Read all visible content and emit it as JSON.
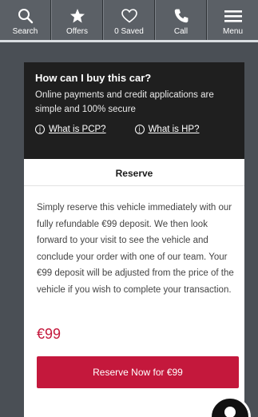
{
  "nav": {
    "items": [
      {
        "label": "Search",
        "icon": "search-icon"
      },
      {
        "label": "Offers",
        "icon": "star-icon"
      },
      {
        "label": "0 Saved",
        "icon": "heart-icon"
      },
      {
        "label": "Call",
        "icon": "phone-icon"
      },
      {
        "label": "Menu",
        "icon": "hamburger-icon"
      }
    ]
  },
  "buy_panel": {
    "title": "How can I buy this car?",
    "body": "Online payments and credit applications are simple and 100% secure",
    "links": [
      "What is PCP?",
      "What is HP?"
    ]
  },
  "reserve": {
    "heading": "Reserve",
    "text": "Simply reserve this vehicle immediately with our fully refundable €99 deposit. We then look forward to your visit to see the vehicle and conclude your order with one of our team. Your €99 deposit will be adjusted from the price of the vehicle if you wish to complete your transaction.",
    "price": "€99",
    "button_label": "Reserve Now for €99"
  },
  "colors": {
    "accent": "#c4183c",
    "nav_bg": "#5b6066",
    "panel_bg": "#1f1f1f"
  }
}
